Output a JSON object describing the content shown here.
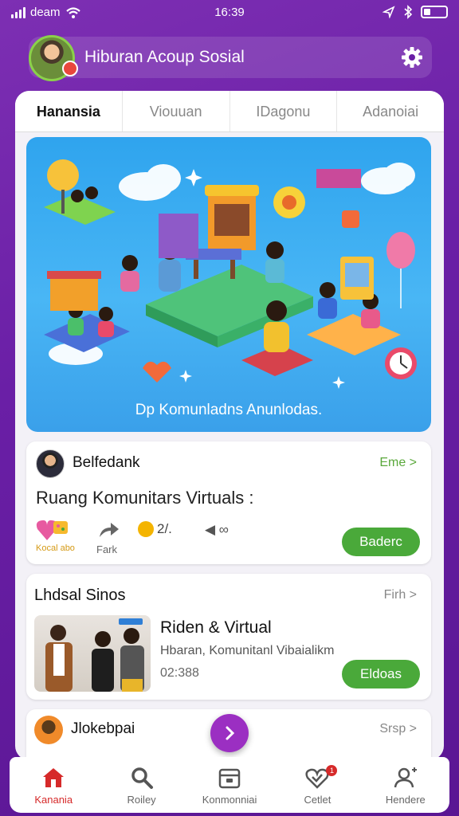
{
  "status_bar": {
    "carrier": "deam",
    "time": "16:39"
  },
  "header": {
    "title": "Hiburan Acoup Sosial",
    "settings_icon": "gear-icon"
  },
  "tabs": [
    {
      "label": "Hanansia",
      "active": true
    },
    {
      "label": "Viouuan",
      "active": false
    },
    {
      "label": "IDagonu",
      "active": false
    },
    {
      "label": "Adanoiai",
      "active": false
    }
  ],
  "hero": {
    "caption": "Dp Komunladns Anunlodas."
  },
  "post": {
    "author": "Belfedank",
    "more": "Eme >",
    "title": "Ruang Komunitars Virtuals :",
    "react_label": "Kocal abo",
    "share_label": "Fark",
    "stats": "2/.",
    "stats_icons": "◀ ∞",
    "button": "Baderc"
  },
  "card2": {
    "title": "Lhdsal Sinos",
    "more": "Firh >",
    "subtitle": "Riden & Virtual",
    "desc": "Hbaran, Komunitanl Vibaialikm",
    "time": "02:388",
    "button": "Eldoas"
  },
  "card3": {
    "title": "Jlokebpai",
    "more": "Srsp >"
  },
  "bottom_nav": [
    {
      "label": "Kanania",
      "icon": "home-icon",
      "active": true
    },
    {
      "label": "Roiley",
      "icon": "search-icon",
      "active": false
    },
    {
      "label": "Konmonniai",
      "icon": "archive-icon",
      "active": false
    },
    {
      "label": "Cetlet",
      "icon": "heart-check-icon",
      "active": false,
      "badge": "1"
    },
    {
      "label": "Hendere",
      "icon": "add-user-icon",
      "active": false
    }
  ],
  "colors": {
    "primary": "#7d2fb3",
    "accent_green": "#4aa93a",
    "active_red": "#d62a2a",
    "fab": "#9b2fc2"
  }
}
